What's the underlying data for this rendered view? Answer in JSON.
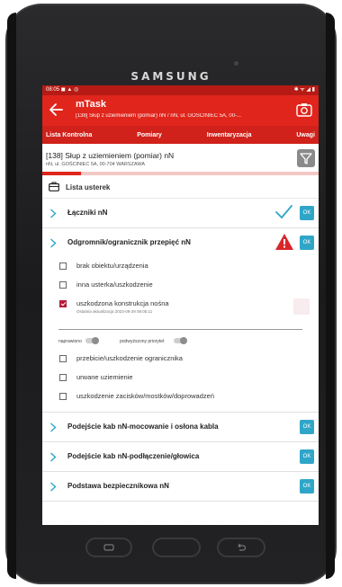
{
  "device": {
    "brand": "SAMSUNG"
  },
  "status": {
    "time": "08:05",
    "icons": "◼ ▲ ◎",
    "right": "✱ ᯤ ◢ ▮"
  },
  "app": {
    "title": "mTask",
    "subtitle": "[138] Słup z uziemieniem (pomiar) nN / nN, ul. GOŚCINIEC 5A, 00-..."
  },
  "tabs": [
    {
      "label": "Lista Kontrolna"
    },
    {
      "label": "Pomiary"
    },
    {
      "label": "Inwentaryzacja"
    },
    {
      "label": "Uwagi"
    }
  ],
  "object": {
    "title": "[138] Słup z uziemieniem (pomiar) nN",
    "address": "nN, ul. GOŚCINIEC 5A, 00-704 WARSZAWA",
    "progress": 0.14
  },
  "list": {
    "header": "Lista usterek",
    "categories": [
      {
        "label": "Łączniki nN",
        "ok": "OK",
        "status": "check"
      },
      {
        "label": "Odgromnik/ogranicznik przepięć nN",
        "ok": "OK",
        "status": "warning",
        "items": [
          {
            "label": "brak obiektu/urządzenia",
            "checked": false
          },
          {
            "label": "inna usterka/uszkodzenie",
            "checked": false
          },
          {
            "label": "uszkodzona konstrukcja nośna",
            "checked": true,
            "sub": "Ostatnia aktualizacja 2023-09-29 08:05:11"
          }
        ],
        "toggles": {
          "repaired": "naprawiono",
          "priority": "podwyższony priorytet"
        },
        "items2": [
          {
            "label": "przebicie/uszkodzenie ogranicznika",
            "checked": false
          },
          {
            "label": "urwane uziemienie",
            "checked": false
          },
          {
            "label": "uszkodzenie zacisków/mostków/doprowadzeń",
            "checked": false
          }
        ]
      },
      {
        "label": "Podejście kab nN-mocowanie i osłona kabla",
        "ok": "OK"
      },
      {
        "label": "Podejście kab nN-podłączenie/głowica",
        "ok": "OK"
      },
      {
        "label": "Podstawa bezpiecznikowa nN",
        "ok": "OK"
      }
    ]
  },
  "colors": {
    "primary": "#e0251c",
    "accent": "#2fa6c8",
    "warning": "#d8262b",
    "check": "#2fa6c8"
  }
}
